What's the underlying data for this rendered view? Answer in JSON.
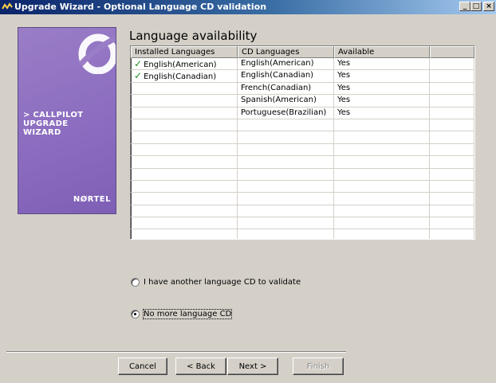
{
  "window": {
    "title": "Upgrade Wizard - Optional Language CD validation",
    "controls": {
      "minimize": "_",
      "maximize": "□",
      "close": "×"
    }
  },
  "banner": {
    "lines": [
      "> CALLPILOT",
      "UPGRADE",
      "WIZARD"
    ],
    "logo": "NØRTEL"
  },
  "heading": "Language availability",
  "table": {
    "columns": [
      "Installed Languages",
      "CD Languages",
      "Available",
      ""
    ],
    "rows": [
      {
        "installed": "English(American)",
        "installed_checked": true,
        "cd": "English(American)",
        "available": "Yes"
      },
      {
        "installed": "English(Canadian)",
        "installed_checked": true,
        "cd": "English(Canadian)",
        "available": "Yes"
      },
      {
        "installed": "",
        "installed_checked": false,
        "cd": "French(Canadian)",
        "available": "Yes"
      },
      {
        "installed": "",
        "installed_checked": false,
        "cd": "Spanish(American)",
        "available": "Yes"
      },
      {
        "installed": "",
        "installed_checked": false,
        "cd": "Portuguese(Brazilian)",
        "available": "Yes"
      }
    ],
    "empty_rows": 10
  },
  "options": {
    "another_cd": {
      "label": "I have another language CD to validate",
      "checked": false
    },
    "no_more": {
      "label": "No more language CD",
      "checked": true
    }
  },
  "buttons": {
    "cancel": "Cancel",
    "back": "< Back",
    "next": "Next >",
    "finish": "Finish"
  }
}
